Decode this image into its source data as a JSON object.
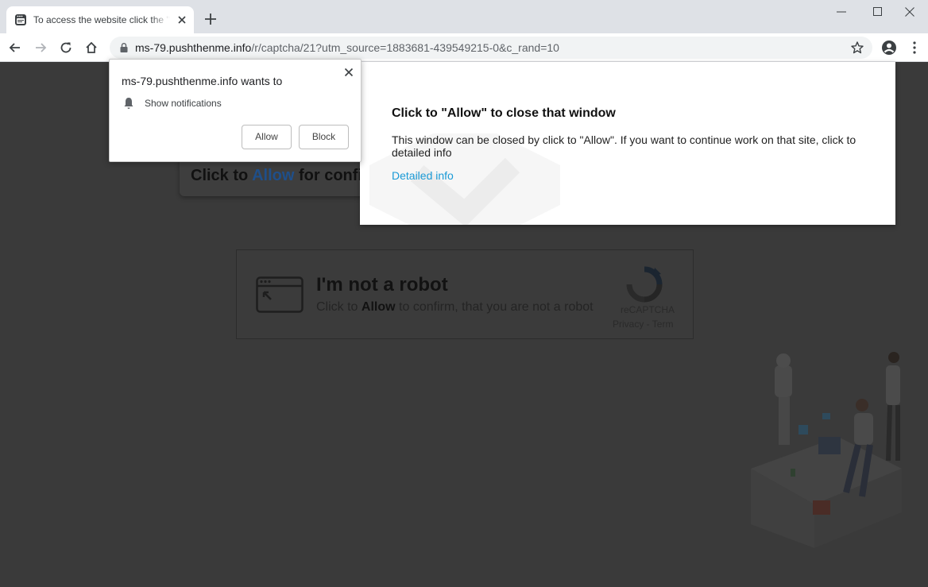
{
  "browser": {
    "tab": {
      "title": "To access the website click the \"Allow\" button"
    },
    "omnibox": {
      "host": "ms-79.pushthenme.info",
      "path": "/r/captcha/21?utm_source=1883681-439549215-0&c_rand=10"
    }
  },
  "permission_prompt": {
    "title": "ms-79.pushthenme.info wants to",
    "permission": "Show notifications",
    "allow_label": "Allow",
    "block_label": "Block"
  },
  "notice": {
    "title": "Click to \"Allow\" to close that window",
    "body": "This window can be closed by click to \"Allow\". If you want to continue work on that site, click to detailed info",
    "link": "Detailed info"
  },
  "page": {
    "banner": {
      "prefix": "Click to",
      "highlight": "Allow",
      "suffix": "for confirm"
    },
    "captcha": {
      "title": "I'm not a robot",
      "sub_prefix": "Click to",
      "sub_bold": "Allow",
      "sub_suffix": "to confirm, that you are not a robot",
      "brand": "reCAPTCHA",
      "links": "Privacy - Term"
    }
  },
  "colors": {
    "dim_overlay": "#3a3a3a",
    "link": "#1a9ad6",
    "tabstrip": "#dee1e6"
  }
}
